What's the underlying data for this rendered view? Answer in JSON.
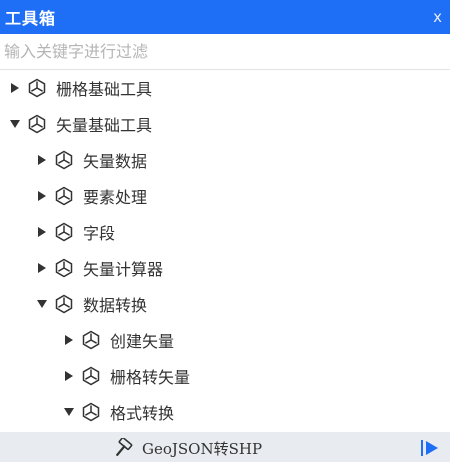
{
  "panel": {
    "title": "工具箱",
    "close_label": "x"
  },
  "search": {
    "placeholder": "输入关键字进行过滤",
    "value": ""
  },
  "tree": {
    "raster_basic": {
      "label": "栅格基础工具",
      "expanded": false
    },
    "vector_basic": {
      "label": "矢量基础工具",
      "expanded": true
    },
    "vector_data": {
      "label": "矢量数据",
      "expanded": false
    },
    "feature_processing": {
      "label": "要素处理",
      "expanded": false
    },
    "field": {
      "label": "字段",
      "expanded": false
    },
    "vector_calculator": {
      "label": "矢量计算器",
      "expanded": false
    },
    "data_conversion": {
      "label": "数据转换",
      "expanded": true
    },
    "create_vector": {
      "label": "创建矢量",
      "expanded": false
    },
    "raster_to_vector": {
      "label": "栅格转矢量",
      "expanded": false
    },
    "format_conversion": {
      "label": "格式转换",
      "expanded": true
    },
    "geojson_to_shp": {
      "label": "GeoJSON转SHP"
    }
  },
  "colors": {
    "accent": "#1e6ff5",
    "tool_row_bg": "#e8ebef",
    "text": "#333333"
  },
  "icons": {
    "node": "cube-icon",
    "tool": "hammer-icon",
    "run": "play-icon",
    "expanded": "caret-down-icon",
    "collapsed": "caret-right-icon"
  }
}
